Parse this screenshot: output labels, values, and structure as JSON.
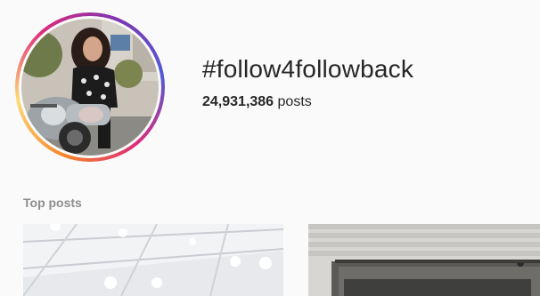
{
  "hashtag": {
    "title": "#follow4followback",
    "post_count": "24,931,386",
    "post_count_suffix": "posts"
  },
  "sections": {
    "top_posts_label": "Top posts"
  },
  "icons": {
    "avatar": "profile-photo",
    "ring": "story-gradient-ring"
  },
  "colors": {
    "background": "#fafafa",
    "text": "#262626",
    "muted": "#8e8e8e"
  }
}
